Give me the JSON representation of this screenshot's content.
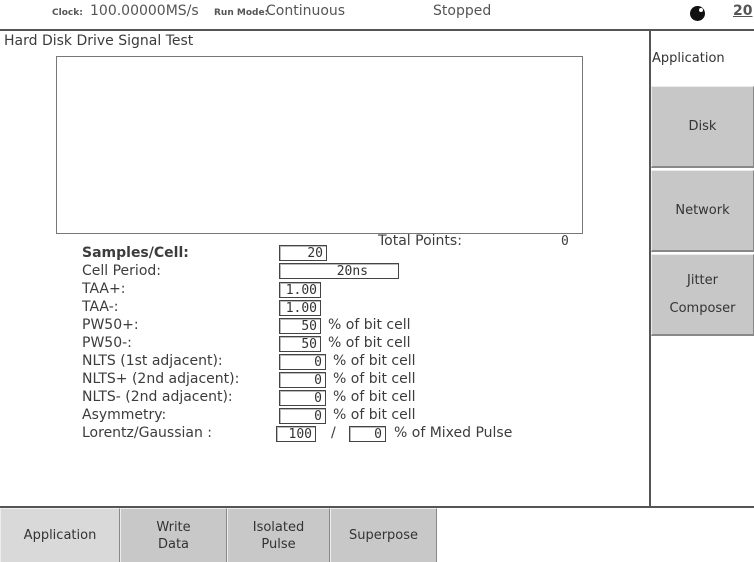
{
  "status": {
    "clock_label": "Clock:",
    "clock_value": "100.00000MS/s",
    "run_mode_label": "Run Mode:",
    "run_mode_value": "Continuous",
    "state": "Stopped",
    "right_number": "20"
  },
  "main": {
    "title": "Hard Disk Drive Signal Test",
    "total_points_label": "Total Points:",
    "total_points_value": "0",
    "params": {
      "samples_label": "Samples/Cell:",
      "samples_value": "20",
      "cell_period_label": "Cell Period:",
      "cell_period_value": "20ns",
      "taa_plus_label": "TAA+:",
      "taa_plus_value": "1.00",
      "taa_minus_label": "TAA-:",
      "taa_minus_value": "1.00",
      "pw50_plus_label": "PW50+:",
      "pw50_plus_value": "50",
      "pw50_minus_label": "PW50-:",
      "pw50_minus_value": "50",
      "nlts1_label": "NLTS (1st adjacent):",
      "nlts1_value": "0",
      "nlts2p_label": "NLTS+ (2nd adjacent):",
      "nlts2p_value": "0",
      "nlts2m_label": "NLTS- (2nd adjacent):",
      "nlts2m_value": "0",
      "asym_label": "Asymmetry:",
      "asym_value": "0",
      "lorentz_label": "Lorentz/Gaussian :",
      "lorentz_value1": "100",
      "lorentz_sep": "/",
      "lorentz_value2": "0",
      "unit_bitcell": "% of bit cell",
      "unit_mixed": "% of Mixed Pulse"
    }
  },
  "side": {
    "header": "Application",
    "buttons": [
      "Disk",
      "Network",
      "Jitter Composer"
    ]
  },
  "tabs": [
    "Application",
    "Write Data",
    "Isolated Pulse",
    "Superpose"
  ]
}
